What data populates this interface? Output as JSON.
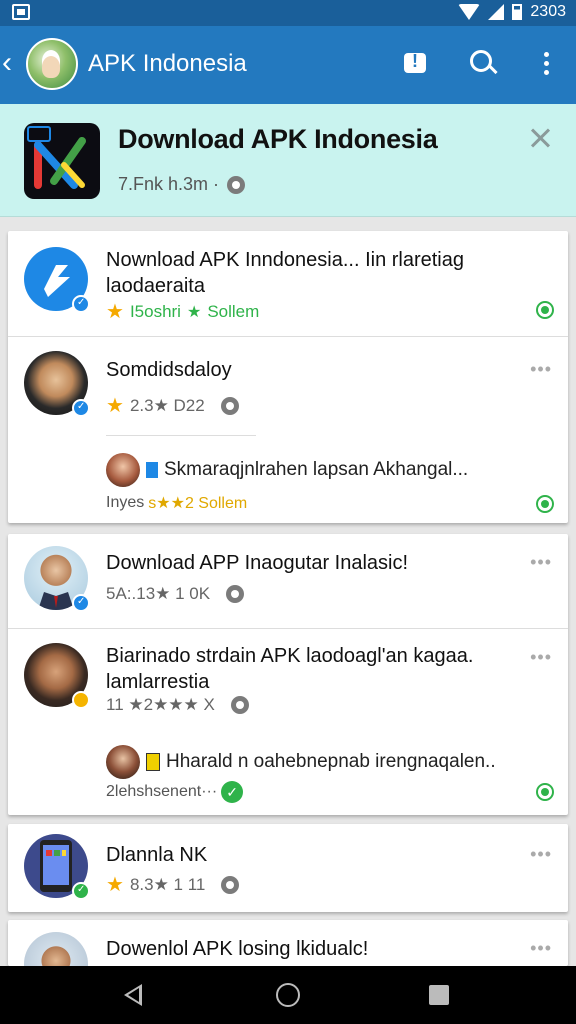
{
  "status_bar": {
    "time": "2303"
  },
  "app_bar": {
    "back_glyph": "‹",
    "title": "APK Indonesia"
  },
  "banner": {
    "title": "Download APK Indonesia",
    "subtitle": "7.Fnk h.3m ·"
  },
  "posts": [
    {
      "title": "Nownload APK Inndonesia... Iin rlaretiag",
      "title2": "laodaeraita",
      "meta1": "I5oshri",
      "meta2": "Sollem"
    },
    {
      "title": "Somdidsdaloy",
      "meta": "2.3★ D22",
      "comment": "Skmaraqjnlrahen lapsan Akhangal...",
      "foot1": "Inyes",
      "foot2": "s★★2 Sollem"
    },
    {
      "title": "Download APP Inaogutar Inalasic!",
      "meta": "5A:.13★ 1 0K"
    },
    {
      "title": "Biarinado strdain APK laodoagl'an kagaa.",
      "title2": "lamlarrestia",
      "meta": "11 ★2★★★ X",
      "comment": "Hharald n oahebnepnab irengnaqalen..",
      "foot1": "2lehshsenent···"
    },
    {
      "title": "Dlannla NK",
      "meta": "8.3★ 1 11"
    },
    {
      "title": "Dowenlol APK losing lkidualc!"
    }
  ],
  "icons": {
    "back": "chevron-left-icon",
    "notice": "notification-icon",
    "search": "search-icon",
    "more": "more-vert-icon",
    "close": "close-icon",
    "settings": "gear-icon",
    "share": "share-icon",
    "nav_back": "nav-back-icon",
    "nav_home": "nav-home-icon",
    "nav_recent": "nav-recent-icon"
  },
  "colors": {
    "appbar": "#2379bf",
    "statusbar": "#1a5f9a",
    "banner": "#c9f3ef",
    "accent_green": "#2fb34a",
    "star": "#f5a900"
  }
}
